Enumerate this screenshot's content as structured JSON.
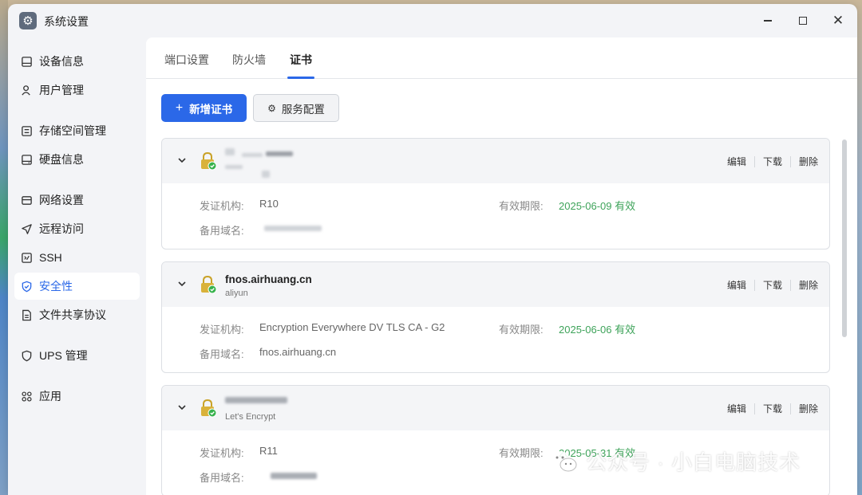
{
  "window": {
    "title": "系统设置",
    "controls": [
      "minimize",
      "maximize",
      "close"
    ]
  },
  "sidebar": {
    "items": [
      {
        "label": "设备信息",
        "icon": "device-icon",
        "active": false
      },
      {
        "label": "用户管理",
        "icon": "user-icon",
        "active": false
      },
      {
        "label": "存储空间管理",
        "icon": "storage-icon",
        "active": false
      },
      {
        "label": "硬盘信息",
        "icon": "disk-icon",
        "active": false
      },
      {
        "label": "网络设置",
        "icon": "network-icon",
        "active": false
      },
      {
        "label": "远程访问",
        "icon": "send-icon",
        "active": false
      },
      {
        "label": "SSH",
        "icon": "terminal-icon",
        "active": false
      },
      {
        "label": "安全性",
        "icon": "shield-icon",
        "active": true
      },
      {
        "label": "文件共享协议",
        "icon": "file-share-icon",
        "active": false
      },
      {
        "label": "UPS 管理",
        "icon": "ups-shield-icon",
        "active": false
      },
      {
        "label": "应用",
        "icon": "apps-icon",
        "active": false
      }
    ]
  },
  "tabs": [
    {
      "label": "端口设置",
      "active": false
    },
    {
      "label": "防火墙",
      "active": false
    },
    {
      "label": "证书",
      "active": true
    }
  ],
  "toolbar": {
    "add_label": "新增证书",
    "config_label": "服务配置"
  },
  "labels": {
    "issuer": "发证机构:",
    "validity": "有效期限:",
    "alt_domain": "备用域名:",
    "edit": "编辑",
    "download": "下载",
    "delete": "删除"
  },
  "certificates": [
    {
      "domain": "",
      "issuer_name": "",
      "issuer": "R10",
      "validity": "2025-06-09 有效",
      "alt_domain": ""
    },
    {
      "domain": "fnos.airhuang.cn",
      "issuer_name": "aliyun",
      "issuer": "Encryption Everywhere DV TLS CA - G2",
      "validity": "2025-06-06 有效",
      "alt_domain": "fnos.airhuang.cn"
    },
    {
      "domain": "",
      "issuer_name": "Let's Encrypt",
      "issuer": "R11",
      "validity": "2025-05-31 有效",
      "alt_domain": ""
    }
  ],
  "watermark": {
    "text": "公众号 · 小白电脑技术",
    "icon": "wechat-icon"
  },
  "colors": {
    "accent": "#2b68e8",
    "valid": "#3ea35a",
    "lock": "#c9a227",
    "lock_check": "#37b24d"
  }
}
